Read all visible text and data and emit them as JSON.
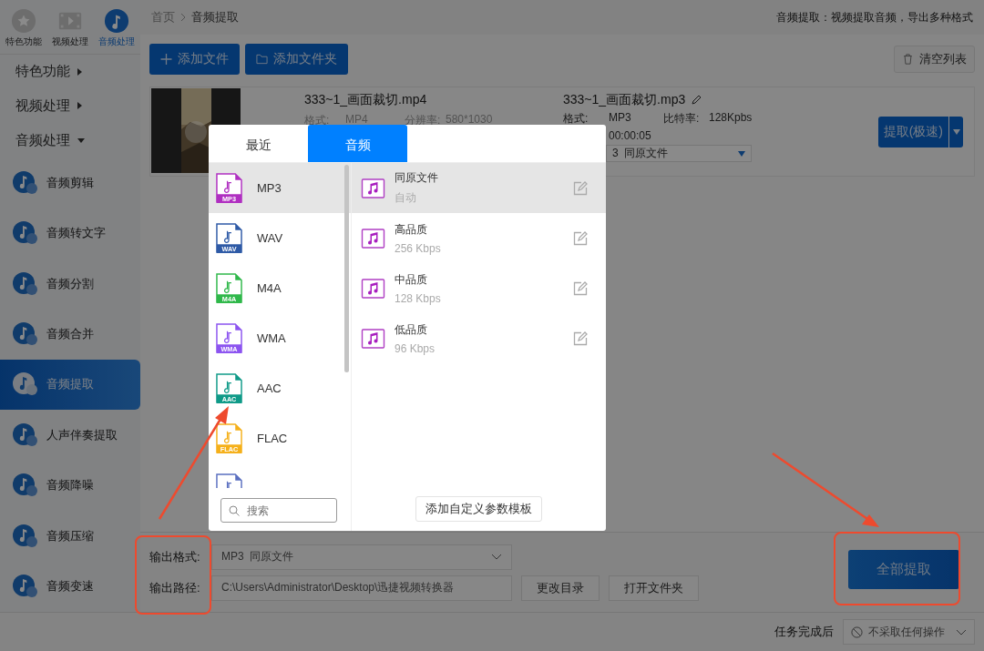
{
  "sidebar": {
    "modes": [
      {
        "label": "特色功能",
        "kind": "star",
        "selected": false
      },
      {
        "label": "视频处理",
        "kind": "film",
        "selected": false
      },
      {
        "label": "音频处理",
        "kind": "note",
        "selected": true
      }
    ],
    "groups": [
      {
        "label": "特色功能",
        "expanded": false
      },
      {
        "label": "视频处理",
        "expanded": false
      },
      {
        "label": "音频处理",
        "expanded": true
      }
    ],
    "items": [
      {
        "label": "音频剪辑",
        "selected": false
      },
      {
        "label": "音频转文字",
        "selected": false
      },
      {
        "label": "音频分割",
        "selected": false
      },
      {
        "label": "音频合并",
        "selected": false
      },
      {
        "label": "音频提取",
        "selected": true
      },
      {
        "label": "人声伴奏提取",
        "selected": false
      },
      {
        "label": "音频降噪",
        "selected": false
      },
      {
        "label": "音频压缩",
        "selected": false
      },
      {
        "label": "音频变速",
        "selected": false
      }
    ]
  },
  "breadcrumb": [
    "首页",
    "音频提取"
  ],
  "header_note": "音频提取：视频提取音频，导出多种格式",
  "toolbar": {
    "add_file": "添加文件",
    "add_folder": "添加文件夹",
    "clear": "清空列表"
  },
  "file": {
    "name": "333~1_画面裁切.mp4",
    "meta": [
      {
        "label": "格式:",
        "value": "MP4"
      },
      {
        "label": "分辨率:",
        "value": "580*1030"
      }
    ],
    "output_name": "333~1_画面裁切.mp3",
    "output_meta": [
      {
        "label": "格式:",
        "value": "MP3"
      },
      {
        "label": "比特率:",
        "value": "128Kpbs"
      }
    ],
    "duration": "00:00:05",
    "preset": "3  同原文件",
    "action": "提取(极速)"
  },
  "popup": {
    "tabs": [
      {
        "label": "最近",
        "selected": false
      },
      {
        "label": "音频",
        "selected": true
      }
    ],
    "formats": [
      {
        "label": "MP3",
        "badge": "MP3",
        "color": "#b02fc1",
        "selected": true
      },
      {
        "label": "WAV",
        "badge": "WAV",
        "color": "#2e5aa6",
        "selected": false
      },
      {
        "label": "M4A",
        "badge": "M4A",
        "color": "#2fb84a",
        "selected": false
      },
      {
        "label": "WMA",
        "badge": "WMA",
        "color": "#8c54f0",
        "selected": false
      },
      {
        "label": "AAC",
        "badge": "AAC",
        "color": "#0f9a88",
        "selected": false
      },
      {
        "label": "FLAC",
        "badge": "FLAC",
        "color": "#f5b01a",
        "selected": false
      },
      {
        "color": "#5a6fc0",
        "selected": false
      }
    ],
    "presets": [
      {
        "name": "同原文件",
        "detail": "自动",
        "selected": true
      },
      {
        "name": "高品质",
        "detail": "256 Kbps",
        "selected": false
      },
      {
        "name": "中品质",
        "detail": "128 Kbps",
        "selected": false
      },
      {
        "name": "低品质",
        "detail": "96 Kbps",
        "selected": false
      }
    ],
    "search": {
      "placeholder": "搜索"
    },
    "add_template": "添加自定义参数模板"
  },
  "output": {
    "format_label": "输出格式:",
    "format_value": "MP3  同原文件",
    "path_label": "输出路径:",
    "path_value": "C:\\Users\\Administrator\\Desktop\\迅捷视频转换器",
    "buttons": [
      "更改目录",
      "打开文件夹"
    ],
    "start": "全部提取"
  },
  "footer": {
    "label": "任务完成后",
    "action": "不采取任何操作"
  }
}
